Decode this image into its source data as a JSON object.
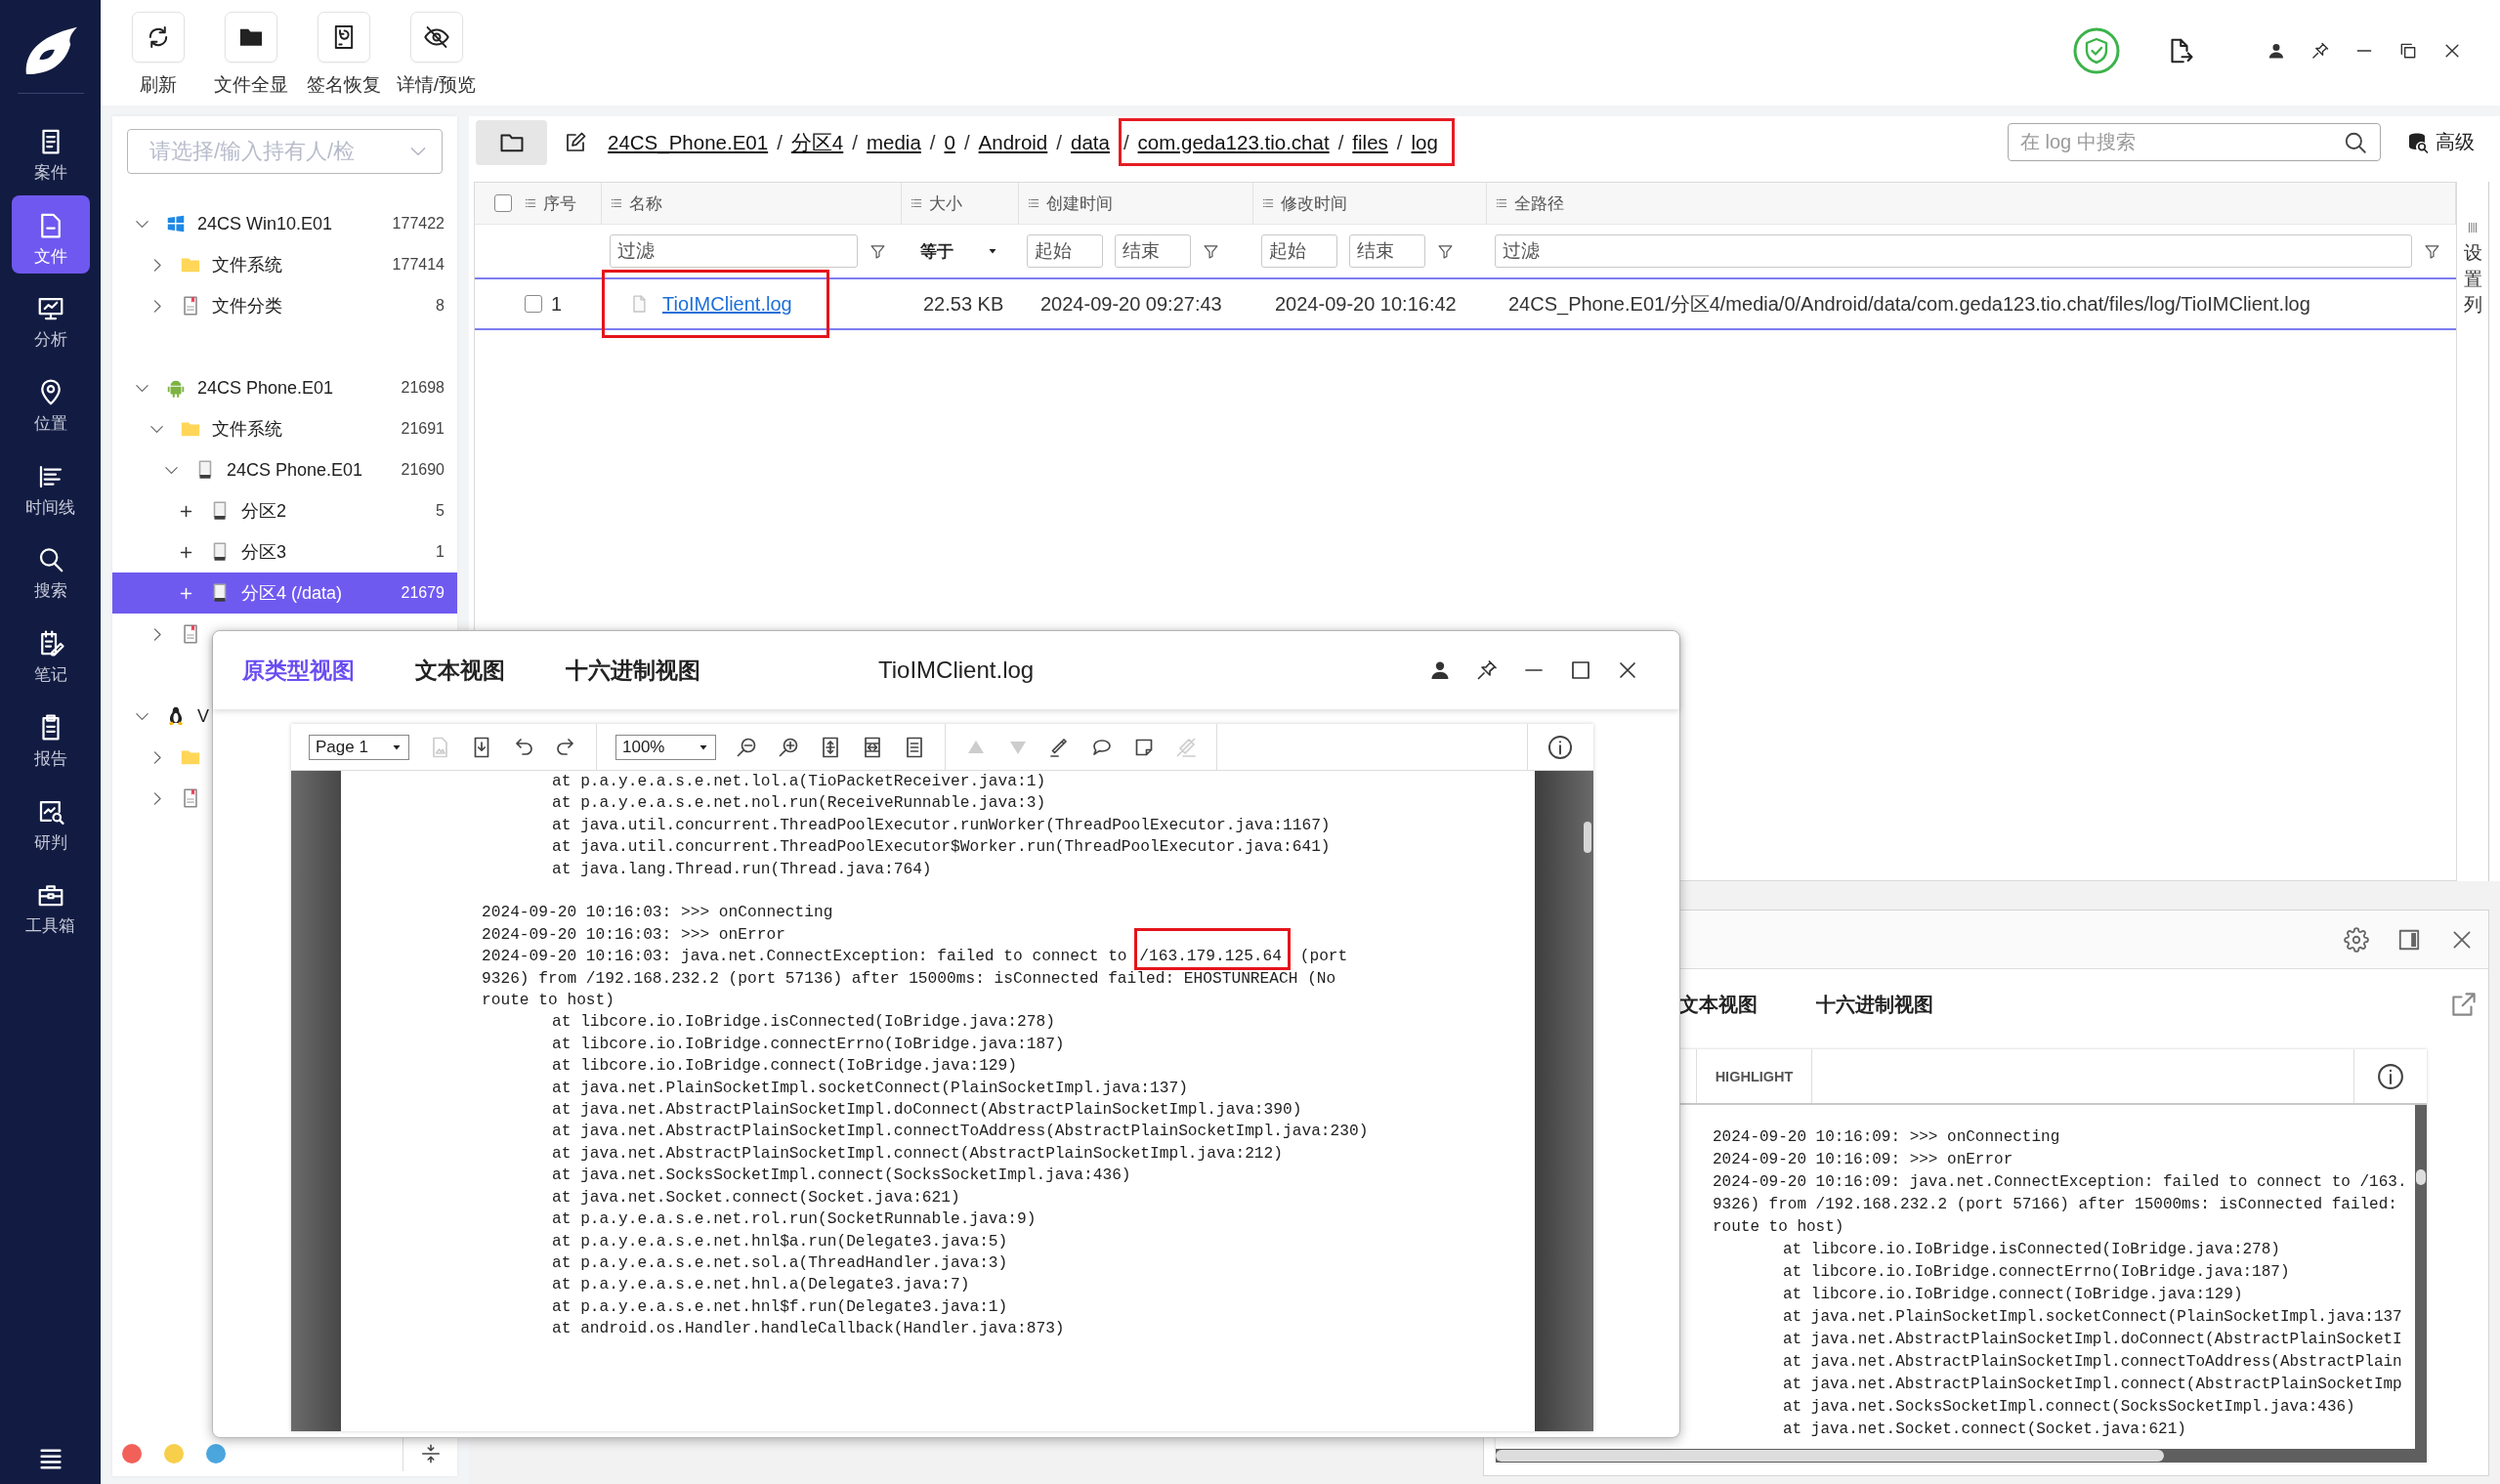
{
  "nav": {
    "items": [
      {
        "label": "案件",
        "selected": false
      },
      {
        "label": "文件",
        "selected": true
      },
      {
        "label": "分析",
        "selected": false
      },
      {
        "label": "位置",
        "selected": false
      },
      {
        "label": "时间线",
        "selected": false
      },
      {
        "label": "搜索",
        "selected": false
      },
      {
        "label": "笔记",
        "selected": false
      },
      {
        "label": "报告",
        "selected": false
      },
      {
        "label": "研判",
        "selected": false
      },
      {
        "label": "工具箱",
        "selected": false
      }
    ]
  },
  "toolbar": {
    "buttons": [
      {
        "label": "刷新"
      },
      {
        "label": "文件全显"
      },
      {
        "label": "签名恢复"
      },
      {
        "label": "详情/预览"
      }
    ]
  },
  "tree": {
    "placeholder": "请选择/输入持有人/检",
    "roots": [
      {
        "kind": "windows",
        "label": "24CS Win10.E01",
        "count": "177422",
        "expanded": true,
        "selected": false,
        "children": [
          {
            "kind": "folder",
            "label": "文件系统",
            "count": "177414",
            "expanded": false,
            "selected": false
          },
          {
            "kind": "category",
            "label": "文件分类",
            "count": "8",
            "expanded": false,
            "selected": false
          }
        ]
      },
      {
        "kind": "android",
        "label": "24CS Phone.E01",
        "count": "21698",
        "expanded": true,
        "selected": false,
        "children": [
          {
            "kind": "folder",
            "label": "文件系统",
            "count": "21691",
            "expanded": true,
            "selected": false,
            "children": [
              {
                "kind": "disk",
                "label": "24CS Phone.E01",
                "count": "21690",
                "expanded": true,
                "selected": false,
                "children": [
                  {
                    "kind": "partition",
                    "label": "分区2",
                    "count": "5",
                    "expanded": false,
                    "selected": false
                  },
                  {
                    "kind": "partition",
                    "label": "分区3",
                    "count": "1",
                    "expanded": false,
                    "selected": false
                  },
                  {
                    "kind": "partition",
                    "label": "分区4 (/data)",
                    "count": "21679",
                    "expanded": false,
                    "selected": true
                  }
                ]
              }
            ]
          },
          {
            "kind": "category",
            "expanded": false,
            "selected": false
          }
        ]
      },
      {
        "kind": "linux",
        "label": "V",
        "expanded": true,
        "selected": false,
        "children": [
          {
            "kind": "folder",
            "expanded": false,
            "selected": false
          },
          {
            "kind": "category",
            "expanded": false,
            "selected": false
          }
        ]
      }
    ]
  },
  "footer": {
    "dots": [
      {
        "color": "#f2605a"
      },
      {
        "color": "#f8cf4a"
      },
      {
        "color": "#4ba6de"
      }
    ]
  },
  "breadcrumb": {
    "segments": [
      {
        "kind": "plain",
        "label": "24CS_Phone.E01"
      },
      {
        "kind": "plain",
        "separator": "/",
        "label": "分区4"
      },
      {
        "kind": "plain",
        "separator": "/",
        "label": "media"
      },
      {
        "kind": "plain",
        "separator": "/",
        "label": "0"
      },
      {
        "kind": "plain",
        "separator": "/",
        "label": "Android"
      },
      {
        "kind": "plain",
        "separator": "/",
        "label": "data"
      },
      {
        "kind": "boxed",
        "separator": "/",
        "label": "com.geda123.tio.chat"
      },
      {
        "kind": "boxed",
        "separator": "/",
        "label": "files"
      },
      {
        "kind": "boxed",
        "separator": "/",
        "label": "log"
      }
    ]
  },
  "search": {
    "placeholder": "在 log 中搜索",
    "advanced_button": "高级"
  },
  "table": {
    "header_checked": false,
    "columns": [
      {
        "label": "序号"
      },
      {
        "label": "名称"
      },
      {
        "label": "大小"
      },
      {
        "label": "创建时间"
      },
      {
        "label": "修改时间"
      },
      {
        "label": "全路径"
      }
    ],
    "filters": [
      {
        "kind": "text",
        "placeholder": "过滤"
      },
      {
        "kind": "select",
        "value": "等于"
      },
      {
        "kind": "range",
        "placeholders": [
          "起始",
          "结束"
        ]
      },
      {
        "kind": "range",
        "placeholders": [
          "起始",
          "结束"
        ]
      },
      {
        "kind": "text",
        "placeholder": "过滤"
      }
    ],
    "rows": [
      {
        "checked": false,
        "selected": true,
        "index": "1",
        "name": "TioIMClient.log",
        "name_marked": true,
        "size": "22.53 KB",
        "created": "2024-09-20 09:27:43",
        "modified": "2024-09-20 10:16:42",
        "path": "24CS_Phone.E01/分区4/media/0/Android/data/com.geda123.tio.chat/files/log/TioIMClient.log"
      }
    ],
    "column_settings": "设置列"
  },
  "popup": {
    "tabs": [
      {
        "label": "原类型视图",
        "selected": true
      },
      {
        "label": "文本视图",
        "selected": false
      },
      {
        "label": "十六进制视图",
        "selected": false
      }
    ],
    "title": "TioIMClient.log",
    "viewer": {
      "page_select": "Page 1",
      "zoom_select": "100%",
      "tools": [
        {
          "disabled": true
        },
        {
          "disabled": false
        },
        {
          "disabled": false
        },
        {
          "disabled": false
        },
        {
          "disabled": false
        },
        {
          "disabled": false
        },
        {
          "disabled": false
        },
        {
          "disabled": false
        },
        {
          "disabled": false
        },
        {
          "disabled": true
        },
        {
          "disabled": true
        },
        {
          "disabled": false
        },
        {
          "disabled": false
        },
        {
          "disabled": false
        },
        {
          "disabled": true
        }
      ],
      "lines": [
        {
          "kind": "stack",
          "text": "at p.a.y.e.a.s.e.net.lol.a(TioPacketReceiver.java:1)"
        },
        {
          "kind": "stack",
          "text": "at p.a.y.e.a.s.e.net.nol.run(ReceiveRunnable.java:3)"
        },
        {
          "kind": "stack",
          "text": "at java.util.concurrent.ThreadPoolExecutor.runWorker(ThreadPoolExecutor.java:1167)"
        },
        {
          "kind": "stack",
          "text": "at java.util.concurrent.ThreadPoolExecutor$Worker.run(ThreadPoolExecutor.java:641)"
        },
        {
          "kind": "stack",
          "text": "at java.lang.Thread.run(Thread.java:764)"
        },
        {
          "kind": "gap"
        },
        {
          "kind": "message",
          "text": "2024-09-20 10:16:03: >>> onConnecting"
        },
        {
          "kind": "message",
          "text": "2024-09-20 10:16:03: >>> onError"
        },
        {
          "kind": "message",
          "parts": [
            {
              "kind": "plain",
              "text": "2024-09-20 10:16:03: java.net.ConnectException: failed to connect to "
            },
            {
              "kind": "boxed",
              "text": "/163.179.125.64"
            },
            {
              "kind": "plain",
              "text": " (port 9326) from /192.168.232.2 (port 57136) after 15000ms: isConnected failed: EHOSTUNREACH (No route to host)"
            }
          ]
        },
        {
          "kind": "stack",
          "text": "at libcore.io.IoBridge.isConnected(IoBridge.java:278)"
        },
        {
          "kind": "stack",
          "text": "at libcore.io.IoBridge.connectErrno(IoBridge.java:187)"
        },
        {
          "kind": "stack",
          "text": "at libcore.io.IoBridge.connect(IoBridge.java:129)"
        },
        {
          "kind": "stack",
          "text": "at java.net.PlainSocketImpl.socketConnect(PlainSocketImpl.java:137)"
        },
        {
          "kind": "stack",
          "text": "at java.net.AbstractPlainSocketImpl.doConnect(AbstractPlainSocketImpl.java:390)"
        },
        {
          "kind": "stack",
          "text": "at java.net.AbstractPlainSocketImpl.connectToAddress(AbstractPlainSocketImpl.java:230)"
        },
        {
          "kind": "stack",
          "text": "at java.net.AbstractPlainSocketImpl.connect(AbstractPlainSocketImpl.java:212)"
        },
        {
          "kind": "stack",
          "text": "at java.net.SocksSocketImpl.connect(SocksSocketImpl.java:436)"
        },
        {
          "kind": "stack",
          "text": "at java.net.Socket.connect(Socket.java:621)"
        },
        {
          "kind": "stack",
          "text": "at p.a.y.e.a.s.e.net.rol.run(SocketRunnable.java:9)"
        },
        {
          "kind": "stack",
          "text": "at p.a.y.e.a.s.e.net.hnl$a.run(Delegate3.java:5)"
        },
        {
          "kind": "stack",
          "text": "at p.a.y.e.a.s.e.net.sol.a(ThreadHandler.java:3)"
        },
        {
          "kind": "stack",
          "text": "at p.a.y.e.a.s.e.net.hnl.a(Delegate3.java:7)"
        },
        {
          "kind": "stack",
          "text": "at p.a.y.e.a.s.e.net.hnl$f.run(Delegate3.java:1)"
        },
        {
          "kind": "stack",
          "text": "at android.os.Handler.handleCallback(Handler.java:873)"
        }
      ]
    }
  },
  "preview": {
    "tabs": [
      {
        "label": "文本视图",
        "selected": false
      },
      {
        "label": "十六进制视图",
        "selected": false
      }
    ],
    "highlight_button": "HIGHLIGHT",
    "lines": [
      {
        "kind": "message",
        "text": "2024-09-20 10:16:09: >>> onConnecting"
      },
      {
        "kind": "message",
        "text": "2024-09-20 10:16:09: >>> onError"
      },
      {
        "kind": "message",
        "text": "2024-09-20 10:16:09: java.net.ConnectException: failed to connect to /163."
      },
      {
        "kind": "message",
        "text": "9326) from /192.168.232.2 (port 57166) after 15000ms: isConnected failed:"
      },
      {
        "kind": "message",
        "text": "route to host)"
      },
      {
        "kind": "stack",
        "text": "at libcore.io.IoBridge.isConnected(IoBridge.java:278)"
      },
      {
        "kind": "stack",
        "text": "at libcore.io.IoBridge.connectErrno(IoBridge.java:187)"
      },
      {
        "kind": "stack",
        "text": "at libcore.io.IoBridge.connect(IoBridge.java:129)"
      },
      {
        "kind": "stack",
        "text": "at java.net.PlainSocketImpl.socketConnect(PlainSocketImpl.java:137"
      },
      {
        "kind": "stack",
        "text": "at java.net.AbstractPlainSocketImpl.doConnect(AbstractPlainSocketI"
      },
      {
        "kind": "stack",
        "text": "at java.net.AbstractPlainSocketImpl.connectToAddress(AbstractPlain"
      },
      {
        "kind": "stack",
        "text": "at java.net.AbstractPlainSocketImpl.connect(AbstractPlainSocketImp"
      },
      {
        "kind": "stack",
        "text": "at java.net.SocksSocketImpl.connect(SocksSocketImpl.java:436)"
      },
      {
        "kind": "stack",
        "text": "at java.net.Socket.connect(Socket.java:621)"
      }
    ]
  }
}
